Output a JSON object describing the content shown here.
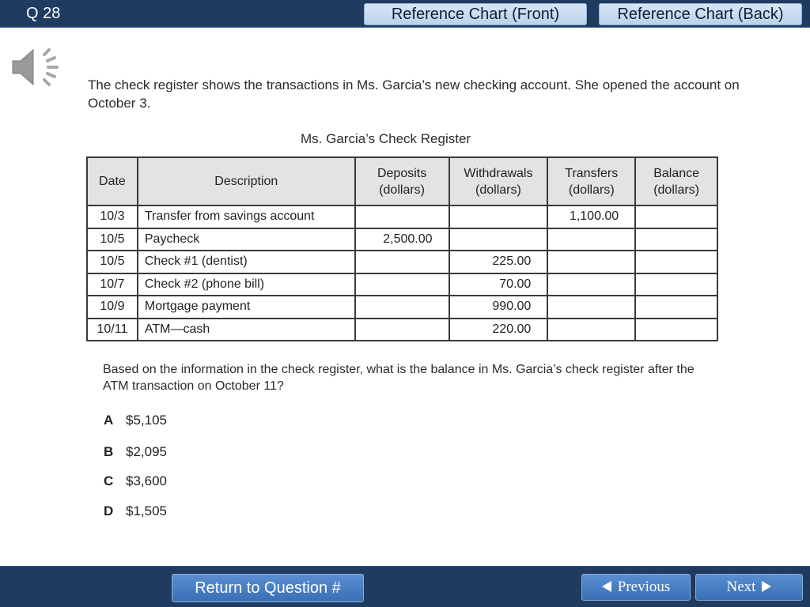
{
  "header": {
    "question_number": "Q 28",
    "ref_front_label": "Reference Chart (Front)",
    "ref_back_label": "Reference Chart (Back)"
  },
  "prompt": "The check register shows the transactions in Ms. Garcia’s new checking account. She opened the account on October 3.",
  "register": {
    "title": "Ms. Garcia’s Check Register",
    "headers": {
      "date": "Date",
      "description": "Description",
      "deposits": "Deposits (dollars)",
      "withdrawals": "Withdrawals (dollars)",
      "transfers": "Transfers (dollars)",
      "balance": "Balance (dollars)"
    },
    "rows": [
      {
        "date": "10/3",
        "description": "Transfer from savings account",
        "deposits": "",
        "withdrawals": "",
        "transfers": "1,100.00",
        "balance": ""
      },
      {
        "date": "10/5",
        "description": "Paycheck",
        "deposits": "2,500.00",
        "withdrawals": "",
        "transfers": "",
        "balance": ""
      },
      {
        "date": "10/5",
        "description": "Check #1 (dentist)",
        "deposits": "",
        "withdrawals": "225.00",
        "transfers": "",
        "balance": ""
      },
      {
        "date": "10/7",
        "description": "Check #2 (phone bill)",
        "deposits": "",
        "withdrawals": "70.00",
        "transfers": "",
        "balance": ""
      },
      {
        "date": "10/9",
        "description": "Mortgage payment",
        "deposits": "",
        "withdrawals": "990.00",
        "transfers": "",
        "balance": ""
      },
      {
        "date": "10/11",
        "description": "ATM—cash",
        "deposits": "",
        "withdrawals": "220.00",
        "transfers": "",
        "balance": ""
      }
    ]
  },
  "question": "Based on the information in the check register, what is the balance in Ms. Garcia’s check register after the ATM transaction on October 11?",
  "choices": [
    {
      "letter": "A",
      "text": "$5,105"
    },
    {
      "letter": "B",
      "text": "$2,095"
    },
    {
      "letter": "C",
      "text": "$3,600"
    },
    {
      "letter": "D",
      "text": "$1,505"
    }
  ],
  "footer": {
    "return_label": "Return to Question #",
    "previous_label": "Previous",
    "next_label": "Next"
  },
  "icons": {
    "audio": "speaker-icon",
    "previous": "triangle-left-icon",
    "next": "triangle-right-icon"
  },
  "colors": {
    "bar": "#1f3b5f",
    "button": "#4a7fc3",
    "ref_button": "#c8dcf1"
  }
}
